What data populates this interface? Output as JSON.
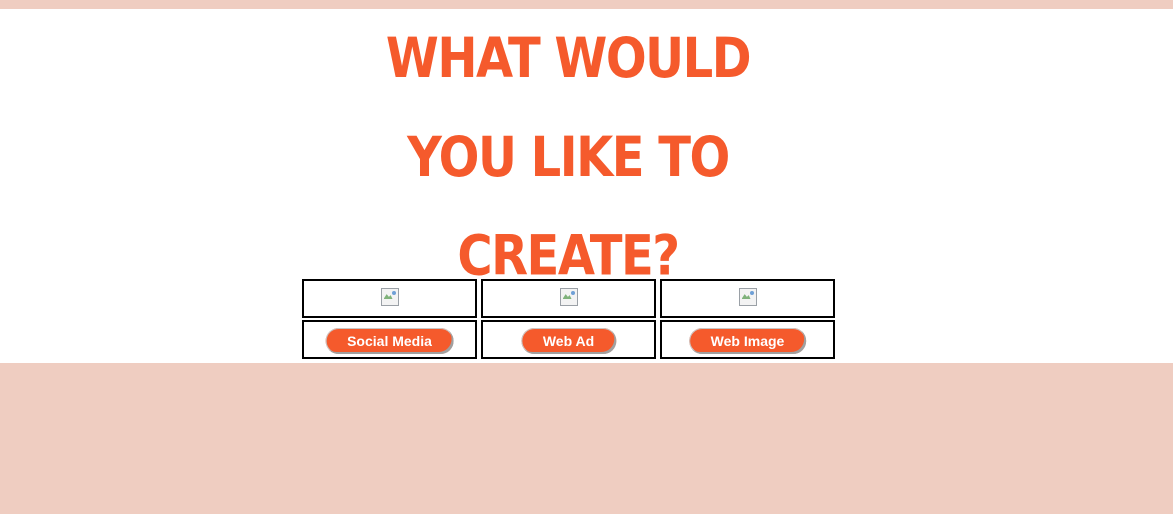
{
  "page": {
    "headline_lines": [
      "WHAT WOULD",
      "YOU LIKE TO",
      "CREATE?"
    ],
    "colors": {
      "accent": "#f55a2c",
      "background": "#efcdc1",
      "panel": "#ffffff",
      "border": "#000000"
    }
  },
  "options": [
    {
      "icon": "broken-image-icon",
      "button_label": "Social Media"
    },
    {
      "icon": "broken-image-icon",
      "button_label": "Web Ad"
    },
    {
      "icon": "broken-image-icon",
      "button_label": "Web Image"
    }
  ]
}
